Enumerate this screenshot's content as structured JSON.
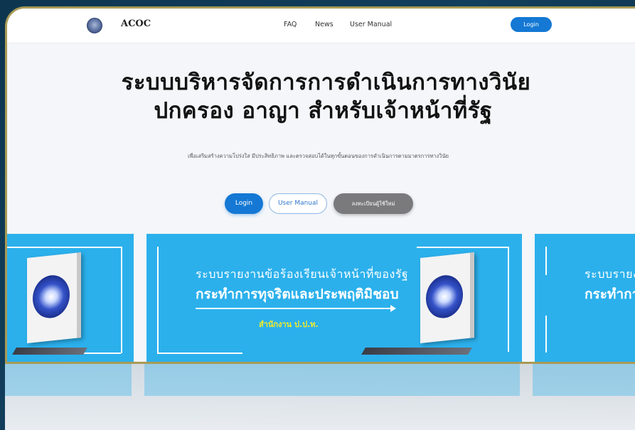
{
  "nav": {
    "brand": "ACOC",
    "links": [
      "FAQ",
      "News",
      "User Manual"
    ],
    "login": "Login"
  },
  "hero": {
    "title_line1": "ระบบบริหารจัดการการดำเนินการทางวินัย",
    "title_line2": "ปกครอง อาญา สำหรับเจ้าหน้าที่รัฐ",
    "subtitle": "เพื่อเสริมสร้างความโปร่งใส มีประสิทธิภาพ และตรวจสอบได้ในทุกขั้นตอนของการดำเนินการตามมาตรการทางวินัย"
  },
  "actions": {
    "login": "Login",
    "manual": "User Manual",
    "register": "ลงทะเบียนผู้ใช้ใหม่"
  },
  "banner": {
    "line1": "ระบบรายงานข้อร้องเรียนเจ้าหน้าที่ของรัฐ",
    "line2": "กระทำการทุจริตและประพฤติมิชอบ",
    "line3": "สำนักงาน ป.ป.ท.",
    "next_line1": "ระบบรายง",
    "next_line2": "กระทำกา"
  },
  "colors": {
    "primary": "#1478d4",
    "banner": "#2bb0ec",
    "highlight": "#f4ec2a",
    "frame": "#a99a55"
  }
}
